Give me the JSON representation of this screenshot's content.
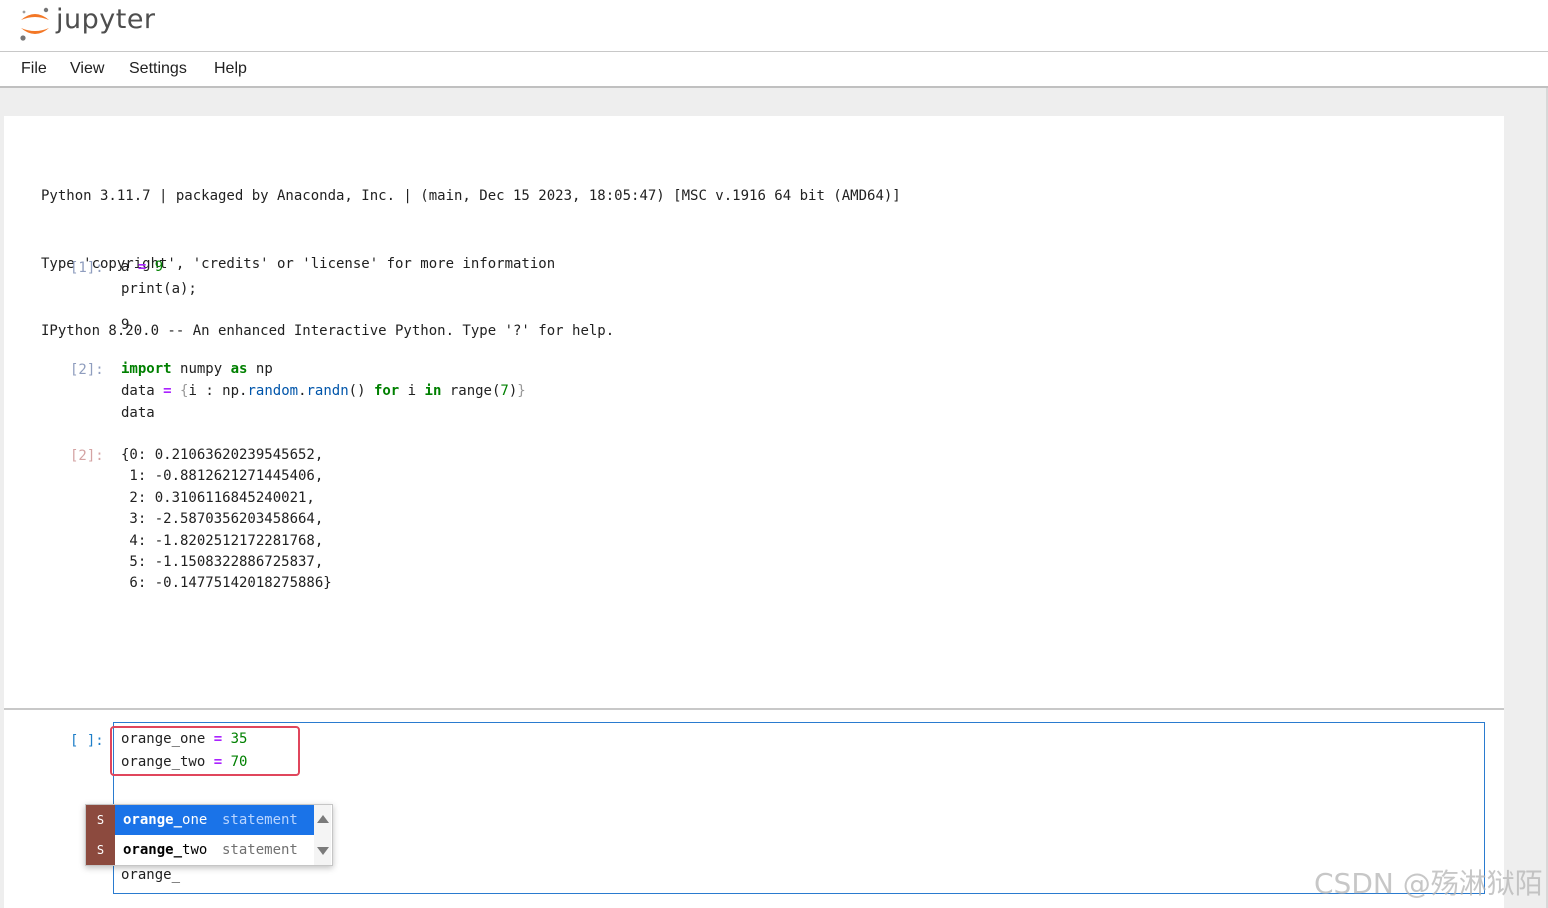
{
  "app": {
    "logo_text": "jupyter"
  },
  "menu": [
    "File",
    "View",
    "Settings",
    "Help"
  ],
  "banner": [
    "Python 3.11.7 | packaged by Anaconda, Inc. | (main, Dec 15 2023, 18:05:47) [MSC v.1916 64 bit (AMD64)]",
    "Type 'copyright', 'credits' or 'license' for more information",
    "IPython 8.20.0 -- An enhanced Interactive Python. Type '?' for help."
  ],
  "cells": {
    "cell1": {
      "in_prompt": "[1]:",
      "line1": {
        "var": "a",
        "op": "=",
        "num": "9"
      },
      "line2": "print(a);",
      "output": "9"
    },
    "cell2": {
      "in_prompt": "[2]:",
      "line1": {
        "kw1": "import",
        "mod": "numpy",
        "kw2": "as",
        "alias": "np"
      },
      "line2": {
        "var": "data",
        "op": "=",
        "open": "{",
        "a": "i : np.",
        "attr1": "random",
        "dot": ".",
        "attr2": "randn",
        "b": "() ",
        "kw_for": "for",
        "c": " i ",
        "kw_in": "in",
        "d": " range(",
        "num": "7",
        "e": ")",
        "close": "}"
      },
      "line3": "data",
      "out_prompt": "[2]:",
      "output": [
        "{0: 0.21063620239545652,",
        " 1: -0.8812621271445406,",
        " 2: 0.3106116845240021,",
        " 3: -2.5870356203458664,",
        " 4: -1.8202512172281768,",
        " 5: -1.1508322886725837,",
        " 6: -0.14775142018275886}"
      ]
    }
  },
  "input_cell": {
    "prompt": "[ ]:",
    "lines": [
      {
        "var": "orange_one",
        "op": "=",
        "num": "35"
      },
      {
        "var": "orange_two",
        "op": "=",
        "num": "70"
      }
    ],
    "typed": "orange_"
  },
  "completer": {
    "items": [
      {
        "type": "S",
        "match": "orange_",
        "rest": "one",
        "kind": "statement",
        "active": true
      },
      {
        "type": "S",
        "match": "orange_",
        "rest": "two",
        "kind": "statement",
        "active": false
      }
    ]
  },
  "watermark": "CSDN @殇淋狱陌",
  "colors": {
    "keyword": "#008000",
    "operator": "#aa22ff",
    "number": "#008000",
    "attribute": "#0055aa",
    "selection": "#1a73e8",
    "highlight_border": "#e0465c",
    "completer_type_bg": "#8c4a3e"
  }
}
